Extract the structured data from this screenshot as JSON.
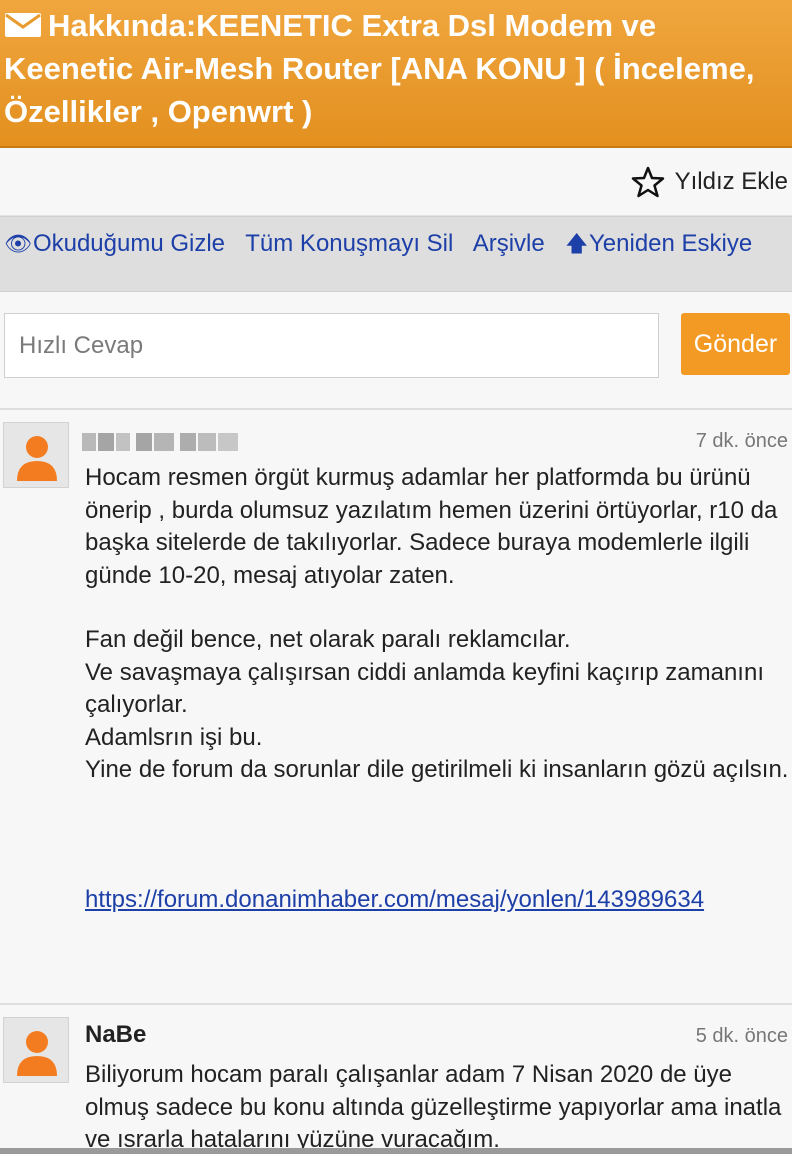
{
  "header": {
    "title": "Hakkında:KEENETIC Extra Dsl Modem ve Keenetic Air-Mesh Router [ANA KONU ] ( İnceleme, Özellikler , Openwrt )",
    "icon": "mail-icon"
  },
  "star_bar": {
    "label": "Yıldız Ekle",
    "icon": "star-outline-icon"
  },
  "actions": {
    "hide_read": "Okuduğumu Gizle",
    "delete_conversation": "Tüm Konuşmayı Sil",
    "archive": "Arşivle",
    "sort": "Yeniden Eskiye",
    "hide_read_icon": "eye-icon",
    "sort_icon": "arrow-up-icon"
  },
  "reply": {
    "placeholder": "Hızlı Cevap",
    "send_label": "Gönder"
  },
  "posts": [
    {
      "username": "",
      "time": "7 dk. önce",
      "paragraphs": [
        "Hocam resmen örgüt kurmuş adamlar her platformda bu ürünü önerip , burda olumsuz yazılatım hemen üzerini örtüyorlar, r10 da başka sitelerde de takılıyorlar. Sadece buraya modemlerle ilgili günde 10-20, mesaj atıyolar zaten.",
        "Fan değil bence, net olarak paralı reklamcılar.",
        "Ve savaşmaya çalışırsan ciddi anlamda keyfini kaçırıp zamanını çalıyorlar.",
        "Adamlsrın işi bu.",
        "Yine de forum da sorunlar dile getirilmeli ki insanların gözü açılsın."
      ],
      "link": "https://forum.donanimhaber.com/mesaj/yonlen/143989634"
    },
    {
      "username": "NaBe",
      "time": "5 dk. önce",
      "paragraphs": [
        "Biliyorum hocam paralı çalışanlar adam 7 Nisan 2020 de üye olmuş sadece bu konu altında güzelleştirme yapıyorlar ama inatla ve ısrarla hatalarını yüzüne vuracağım."
      ]
    }
  ],
  "colors": {
    "header": "#e99a2c",
    "button": "#f39a25",
    "link": "#1d3fa8",
    "avatar": "#f47c20"
  }
}
